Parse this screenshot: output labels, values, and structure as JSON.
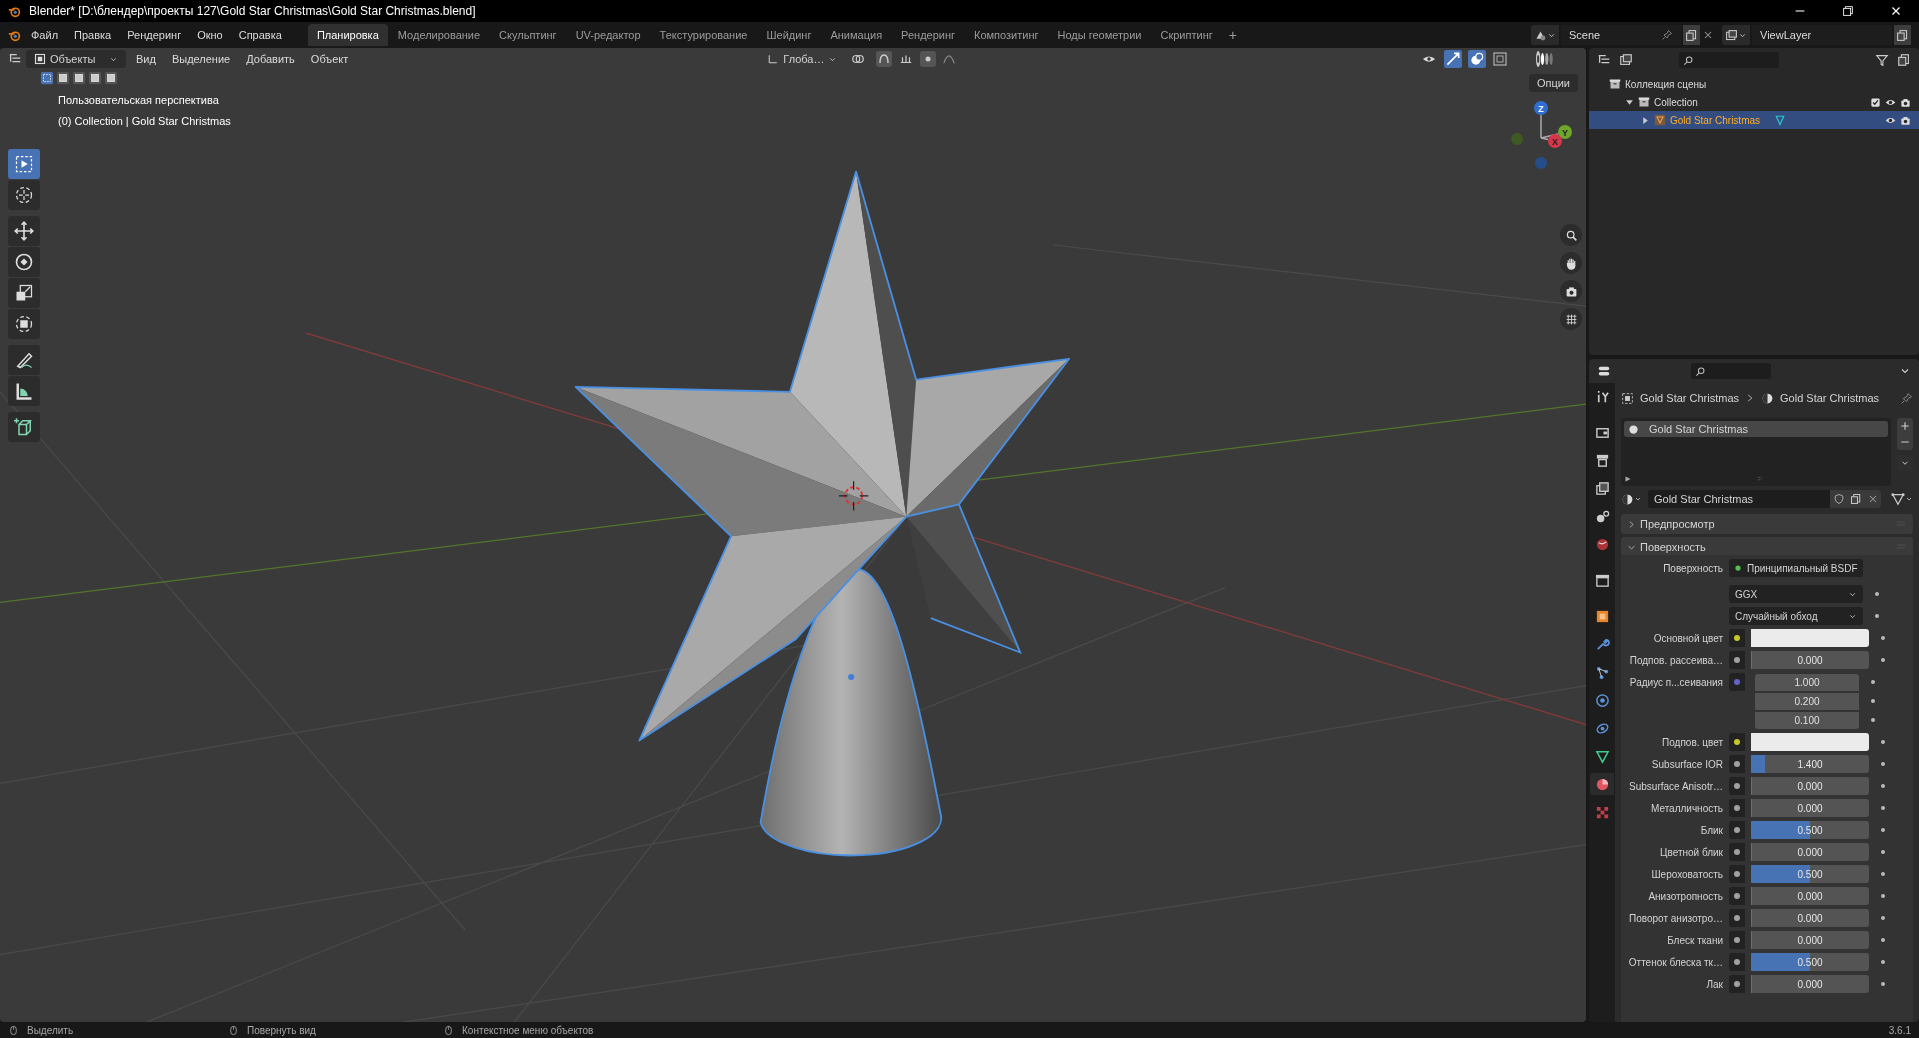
{
  "window": {
    "title": "Blender* [D:\\блендер\\проекты 127\\Gold Star Christmas\\Gold Star Christmas.blend]"
  },
  "menu": [
    "Файл",
    "Правка",
    "Рендеринг",
    "Окно",
    "Справка"
  ],
  "workspaces": [
    {
      "label": "Планировка",
      "selected": true
    },
    {
      "label": "Моделирование",
      "selected": false
    },
    {
      "label": "Скульптинг",
      "selected": false
    },
    {
      "label": "UV-редактор",
      "selected": false
    },
    {
      "label": "Текстурирование",
      "selected": false
    },
    {
      "label": "Шейдинг",
      "selected": false
    },
    {
      "label": "Анимация",
      "selected": false
    },
    {
      "label": "Рендеринг",
      "selected": false
    },
    {
      "label": "Композитинг",
      "selected": false
    },
    {
      "label": "Ноды геометрии",
      "selected": false
    },
    {
      "label": "Скриптинг",
      "selected": false
    }
  ],
  "add_workspace": "+",
  "scene": "Scene",
  "view_layer": "ViewLayer",
  "viewport": {
    "mode": "Объекты",
    "menus": [
      "Вид",
      "Выделение",
      "Добавить",
      "Объект"
    ],
    "orientation": "Глоба…",
    "options": "Опции",
    "select_modes": [
      {
        "selected": true
      },
      {
        "selected": false
      },
      {
        "selected": false
      },
      {
        "selected": false
      },
      {
        "selected": false
      }
    ],
    "overlay": [
      "Пользовательская перспектива",
      "(0) Collection | Gold Star Christmas"
    ],
    "tools": [
      [
        {
          "kind": "select",
          "selected": true
        },
        {
          "kind": "cursor",
          "selected": false
        }
      ],
      [
        {
          "kind": "move",
          "selected": false
        },
        {
          "kind": "rotate",
          "selected": false
        },
        {
          "kind": "scale",
          "selected": false
        },
        {
          "kind": "transform",
          "selected": false
        }
      ],
      [
        {
          "kind": "annotate",
          "selected": false
        },
        {
          "kind": "measure",
          "selected": false
        }
      ],
      [
        {
          "kind": "add-cube",
          "selected": false
        }
      ]
    ],
    "gizmo": [
      "Z",
      "Y",
      "X"
    ]
  },
  "outliner": {
    "items": [
      {
        "label": "Коллекция сцены",
        "kind": "scene-collection",
        "children": [
          {
            "label": "Collection",
            "kind": "collection",
            "expanded": true,
            "checked": true,
            "selected": false,
            "children": [
              {
                "label": "Gold Star Christmas",
                "kind": "object",
                "expanded": false,
                "selected": true
              }
            ]
          }
        ]
      }
    ]
  },
  "properties": {
    "tabs": [
      {
        "kind": "tool",
        "selected": false
      },
      {
        "kind": "render",
        "selected": false
      },
      {
        "kind": "output",
        "selected": false
      },
      {
        "kind": "view-layer",
        "selected": false
      },
      {
        "kind": "scene",
        "selected": false
      },
      {
        "kind": "world",
        "selected": false
      },
      {
        "kind": "collection",
        "selected": false
      },
      {
        "kind": "object",
        "selected": false
      },
      {
        "kind": "modifier",
        "selected": false
      },
      {
        "kind": "particles",
        "selected": false
      },
      {
        "kind": "physics",
        "selected": false
      },
      {
        "kind": "constraint",
        "selected": false
      },
      {
        "kind": "data",
        "selected": false
      },
      {
        "kind": "material",
        "selected": true
      },
      {
        "kind": "texture",
        "selected": false
      }
    ],
    "breadcrumb": [
      "Gold Star Christmas",
      "Gold Star Christmas"
    ],
    "slots": [
      {
        "name": "Gold Star Christmas",
        "selected": true
      }
    ],
    "material": "Gold Star Christmas",
    "panels": [
      {
        "label": "Предпросмотр",
        "expanded": false
      },
      {
        "label": "Поверхность",
        "expanded": true
      }
    ],
    "surface": {
      "label": "Поверхность",
      "shader": "Принципиальный BSDF"
    },
    "dropdowns": [
      "GGX",
      "Случайный обход"
    ],
    "rows": [
      {
        "label": "Основной цвет",
        "kind": "color"
      },
      {
        "label": "Подпов. рассеива…",
        "kind": "value",
        "value": "0.000",
        "level": 0
      },
      {
        "label": "Радиус п...сеивания",
        "kind": "vector",
        "values": [
          "1.000",
          "0.200",
          "0.100"
        ]
      },
      {
        "label": "Подпов. цвет",
        "kind": "color"
      },
      {
        "label": "Subsurface IOR",
        "kind": "value",
        "value": "1.400",
        "level": 0.12
      },
      {
        "label": "Subsurface Anisotr…",
        "kind": "value",
        "value": "0.000",
        "level": 0
      },
      {
        "label": "Металличность",
        "kind": "value",
        "value": "0.000",
        "level": 0
      },
      {
        "label": "Блик",
        "kind": "value",
        "value": "0.500",
        "level": 0.5
      },
      {
        "label": "Цветной блик",
        "kind": "value",
        "value": "0.000",
        "level": 0
      },
      {
        "label": "Шероховатость",
        "kind": "value",
        "value": "0.500",
        "level": 0.5
      },
      {
        "label": "Анизотропность",
        "kind": "value",
        "value": "0.000",
        "level": 0
      },
      {
        "label": "Поворот анизотро…",
        "kind": "value",
        "value": "0.000",
        "level": 0
      },
      {
        "label": "Блеск ткани",
        "kind": "value",
        "value": "0.000",
        "level": 0
      },
      {
        "label": "Оттенок блеска тк…",
        "kind": "value",
        "value": "0.500",
        "level": 0.5
      },
      {
        "label": "Лак",
        "kind": "value",
        "value": "0.000",
        "level": 0
      }
    ]
  },
  "status_bar": {
    "hints": [
      "Выделить",
      "Повернуть вид",
      "Контекстное меню объектов"
    ],
    "version": "3.6.1"
  }
}
